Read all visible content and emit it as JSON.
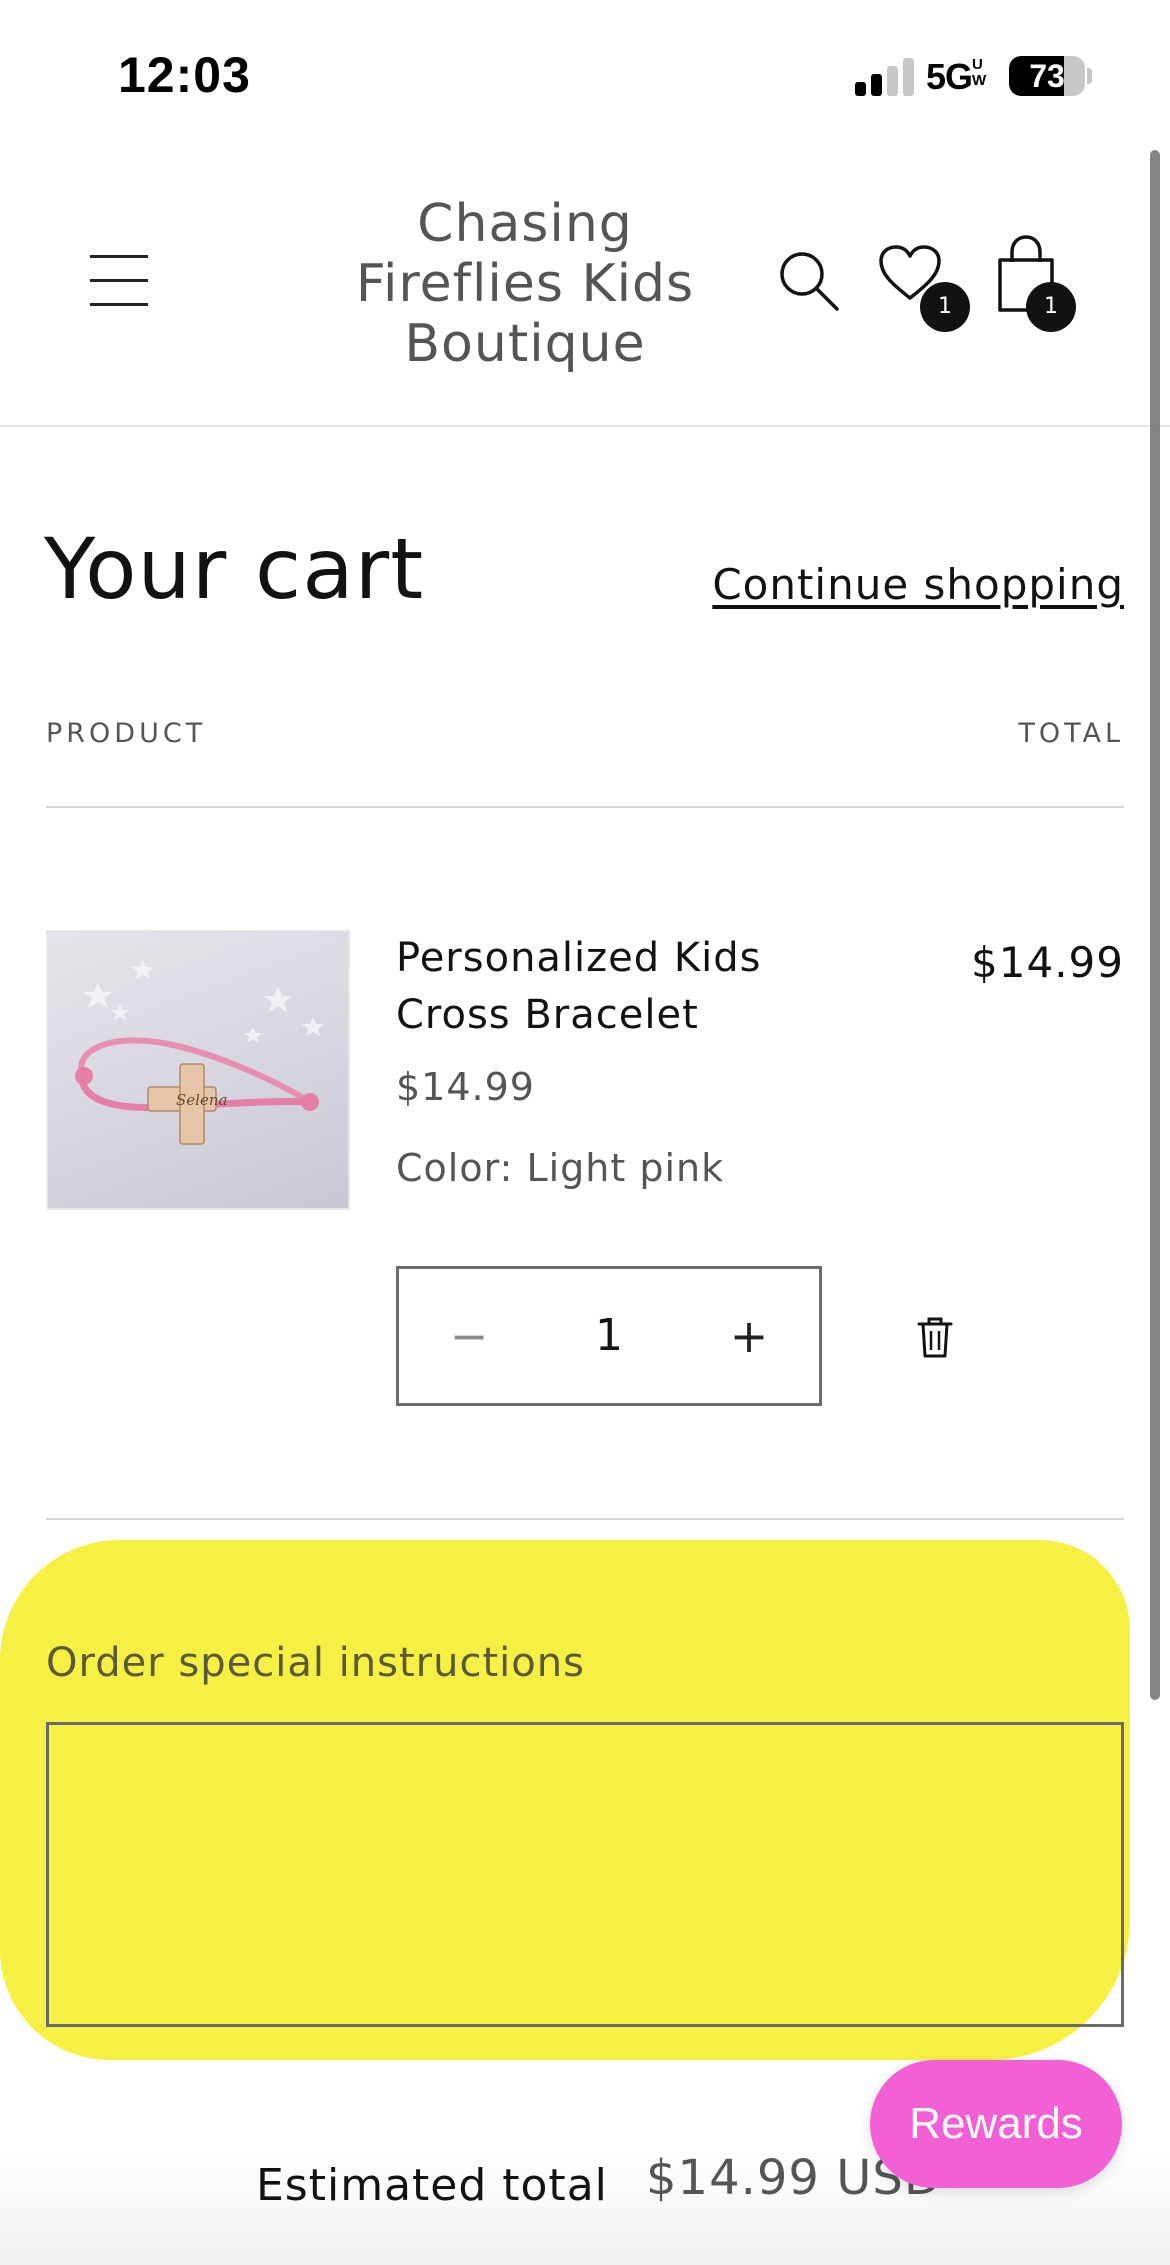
{
  "status_bar": {
    "time": "12:03",
    "network": "5G",
    "network_sub": "UW",
    "battery_percent": 73,
    "battery_label": "73"
  },
  "header": {
    "site_title": "Chasing Fireflies Kids Boutique",
    "wishlist_count": "1",
    "cart_count": "1",
    "icons": [
      "menu-icon",
      "search-icon",
      "heart-icon",
      "shopping-bag-icon"
    ]
  },
  "cart": {
    "title": "Your cart",
    "continue_shopping": "Continue shopping",
    "columns": {
      "product": "PRODUCT",
      "total": "TOTAL"
    },
    "items": [
      {
        "name": "Personalized Kids Cross Bracelet",
        "price": "$14.99",
        "option_label": "Color:",
        "option_value": "Light pink",
        "quantity": "1",
        "line_total": "$14.99",
        "image_engraving": "Selena"
      }
    ],
    "decrease_symbol": "−",
    "increase_symbol": "+",
    "remove_icon": "trash-icon"
  },
  "special_instructions": {
    "label": "Order special instructions",
    "value": ""
  },
  "footer": {
    "estimated_label": "Estimated total",
    "estimated_value": "$14.99 USD",
    "rewards_label": "Rewards"
  },
  "colors": {
    "highlight": "#f7ef3a",
    "rewards": "#f35fd5",
    "text": "#121212",
    "muted": "#555555"
  }
}
